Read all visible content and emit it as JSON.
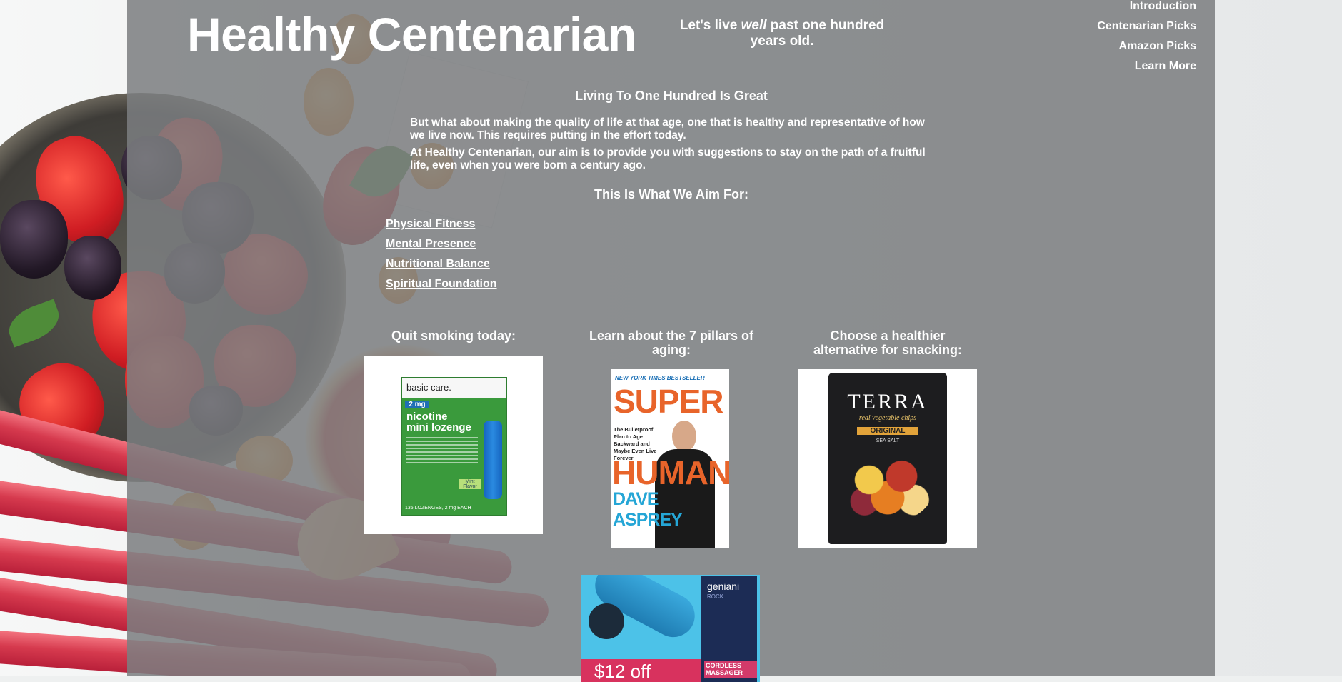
{
  "site": {
    "title": "Healthy Centenarian",
    "tagline_before": "Let's live ",
    "tagline_emphasis": "well",
    "tagline_after": " past one hundred years old."
  },
  "nav": {
    "items": [
      {
        "label": "Introduction"
      },
      {
        "label": "Centenarian Picks"
      },
      {
        "label": "Amazon Picks"
      },
      {
        "label": "Learn More"
      }
    ]
  },
  "intro": {
    "heading": "Living To One Hundred Is Great",
    "paragraph1": "But what about making the quality of life at that age, one that is healthy and representative of how we live now. This requires putting in the effort today.",
    "paragraph2": "At Healthy Centenarian, our aim is to provide you with suggestions to stay on the path of a fruitful life, even when you were born a century ago."
  },
  "aims": {
    "heading": "This Is What We Aim For:",
    "items": [
      "Physical Fitness",
      "Mental Presence",
      "Nutritional Balance",
      "Spiritual Foundation"
    ]
  },
  "promos": [
    {
      "title": "Quit smoking today:",
      "product": {
        "brand": "basic care.",
        "strength": "2 mg",
        "name_line1": "nicotine",
        "name_line2": "mini lozenge",
        "count": "135 LOZENGES, 2 mg EACH",
        "flavor": "Mint Flavor"
      }
    },
    {
      "title": "Learn about the 7 pillars of aging:",
      "product": {
        "banner": "NEW YORK TIMES BESTSELLER",
        "word1": "SUPER",
        "word2": "HUMAN",
        "subtitle": "The Bulletproof Plan to Age Backward and Maybe Even Live Forever",
        "author": "DAVE ASPREY"
      }
    },
    {
      "title": "Choose a healthier alternative for snacking:",
      "product": {
        "brand": "TERRA",
        "line": "real vegetable chips",
        "variety": "ORIGINAL",
        "detail": "SEA SALT"
      }
    }
  ],
  "massager": {
    "brand": "geniani",
    "model": "ROCK",
    "badge": "CORDLESS MASSAGER",
    "offer": "$12 off"
  },
  "colors": {
    "overlay": "#7c7e80",
    "text": "#ffffff",
    "nicotine_green": "#3a9a3c",
    "book_orange": "#e8642a",
    "book_blue": "#25a6d6",
    "terra_black": "#1d1d1f",
    "massager_blue": "#41b9e3"
  }
}
